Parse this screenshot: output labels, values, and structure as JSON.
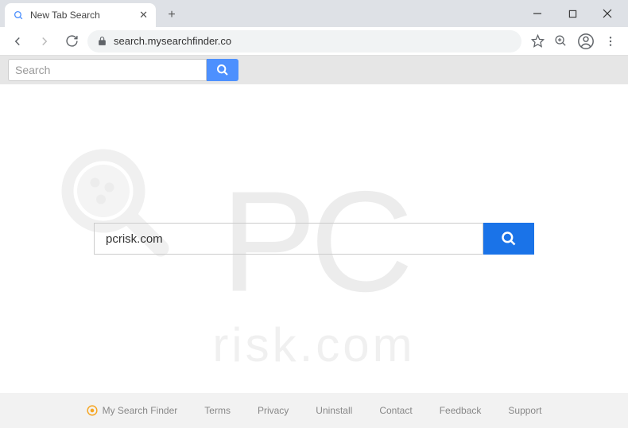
{
  "browser": {
    "tab_title": "New Tab Search",
    "url": "search.mysearchfinder.co"
  },
  "top_search": {
    "placeholder": "Search"
  },
  "main_search": {
    "value": "pcrisk.com"
  },
  "watermark": {
    "big": "PC",
    "sub": "risk.com"
  },
  "footer": {
    "brand": "My Search Finder",
    "links": [
      "Terms",
      "Privacy",
      "Uninstall",
      "Contact",
      "Feedback",
      "Support"
    ]
  }
}
